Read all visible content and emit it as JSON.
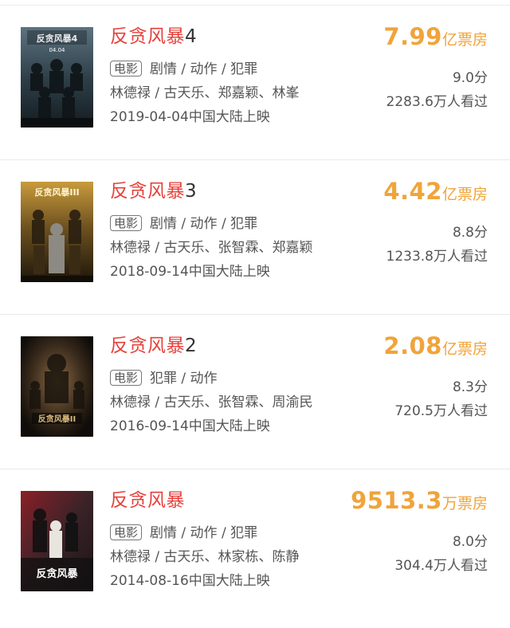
{
  "movies": [
    {
      "title": "反贪风暴",
      "title_num": "4",
      "box_value": "7.99",
      "box_unit": "亿票房",
      "tag": "电影",
      "genres": "剧情 / 动作 / 犯罪",
      "score": "9.0分",
      "cast": "林德禄 / 古天乐、郑嘉颖、林峯",
      "viewers": "2283.6万人看过",
      "release": "2019-04-04中国大陆上映",
      "poster_text": "反贪风暴4",
      "poster_date": "04.04",
      "poster_colors": [
        "#2b3a44",
        "#4f6470",
        "#b9c2c6"
      ]
    },
    {
      "title": "反贪风暴",
      "title_num": "3",
      "box_value": "4.42",
      "box_unit": "亿票房",
      "tag": "电影",
      "genres": "剧情 / 动作 / 犯罪",
      "score": "8.8分",
      "cast": "林德禄 / 古天乐、张智霖、郑嘉颖",
      "viewers": "1233.8万人看过",
      "release": "2018-09-14中国大陆上映",
      "poster_text": "反贪风暴III",
      "poster_date": "",
      "poster_colors": [
        "#3a2c12",
        "#a07a2c",
        "#e2c270"
      ]
    },
    {
      "title": "反贪风暴",
      "title_num": "2",
      "box_value": "2.08",
      "box_unit": "亿票房",
      "tag": "电影",
      "genres": "犯罪 / 动作",
      "score": "8.3分",
      "cast": "林德禄 / 古天乐、张智霖、周渝民",
      "viewers": "720.5万人看过",
      "release": "2016-09-14中国大陆上映",
      "poster_text": "反贪风暴II",
      "poster_date": "",
      "poster_colors": [
        "#1a1510",
        "#5b4630",
        "#c9a36a"
      ]
    },
    {
      "title": "反贪风暴",
      "title_num": "",
      "box_value": "9513.3",
      "box_unit": "万票房",
      "tag": "电影",
      "genres": "剧情 / 动作 / 犯罪",
      "score": "8.0分",
      "cast": "林德禄 / 古天乐、林家栋、陈静",
      "viewers": "304.4万人看过",
      "release": "2014-08-16中国大陆上映",
      "poster_text": "反贪风暴",
      "poster_date": "",
      "poster_colors": [
        "#2c2024",
        "#7a1f25",
        "#d6d1cb"
      ]
    }
  ]
}
